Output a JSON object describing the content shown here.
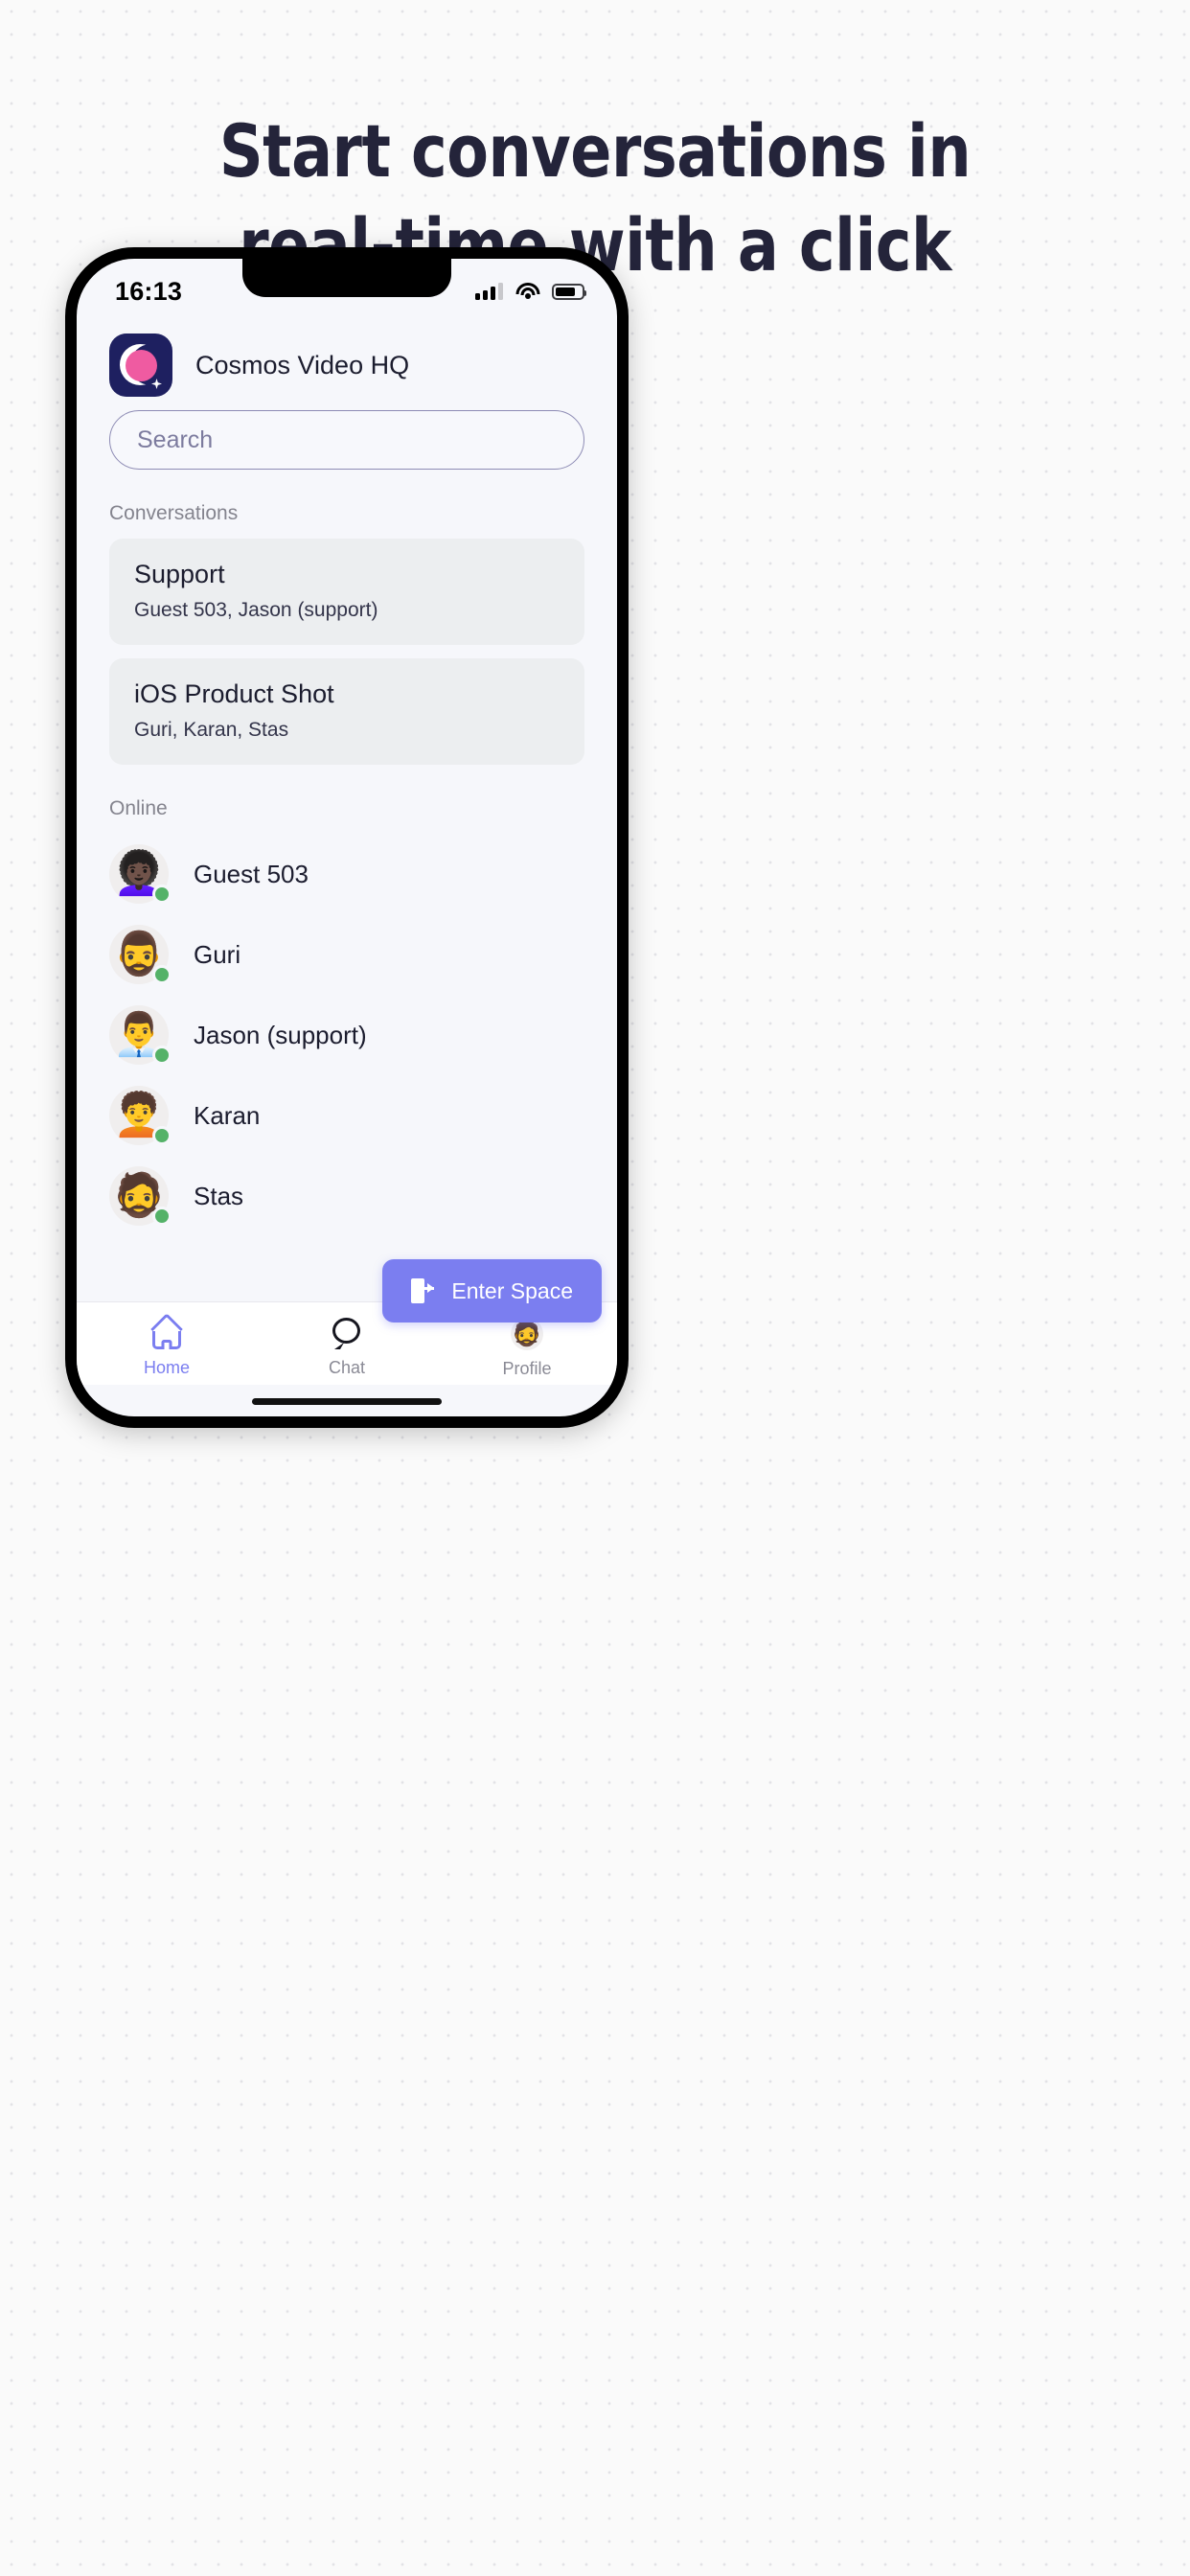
{
  "headline": {
    "line1": "Start conversations in",
    "line2": "real-time with a click"
  },
  "colors": {
    "accent": "#7b7ef0",
    "brand_navy": "#1e2060",
    "brand_pink": "#ef5ba1",
    "online_green": "#54b268",
    "headline": "#24243a",
    "screen_bg": "#f6f7fb",
    "card_bg": "#eceef0"
  },
  "status_bar": {
    "time": "16:13",
    "signal_icon": "cellular-signal-icon",
    "signal_bars_filled": 3,
    "signal_bars_total": 4,
    "wifi_icon": "wifi-icon",
    "battery_icon": "battery-icon",
    "battery_level": "76%"
  },
  "app_header": {
    "logo_icon": "cosmos-video-logo",
    "title": "Cosmos Video HQ"
  },
  "search": {
    "placeholder": "Search",
    "value": ""
  },
  "conversations": {
    "label": "Conversations",
    "items": [
      {
        "title": "Support",
        "members": "Guest 503, Jason (support)"
      },
      {
        "title": "iOS Product Shot",
        "members": "Guri, Karan, Stas"
      }
    ]
  },
  "online": {
    "label": "Online",
    "people": [
      {
        "name": "Guest 503",
        "avatar_icon": "avatar-guest-503",
        "emoji": "👩🏿‍🦱",
        "status": "online"
      },
      {
        "name": "Guri",
        "avatar_icon": "avatar-guri",
        "emoji": "🧔‍♂️",
        "status": "online"
      },
      {
        "name": "Jason (support)",
        "avatar_icon": "avatar-jason",
        "emoji": "👨‍💼",
        "status": "online"
      },
      {
        "name": "Karan",
        "avatar_icon": "avatar-karan",
        "emoji": "🧑‍🦱",
        "status": "online"
      },
      {
        "name": "Stas",
        "avatar_icon": "avatar-stas",
        "emoji": "🧔",
        "status": "online"
      }
    ]
  },
  "enter_space_button": {
    "label": "Enter Space",
    "icon": "enter-door-icon"
  },
  "bottom_nav": {
    "items": [
      {
        "label": "Home",
        "icon": "home-icon",
        "active": true
      },
      {
        "label": "Chat",
        "icon": "chat-bubble-icon",
        "active": false
      },
      {
        "label": "Profile",
        "icon": "profile-avatar-icon",
        "emoji": "🧔",
        "active": false
      }
    ]
  }
}
